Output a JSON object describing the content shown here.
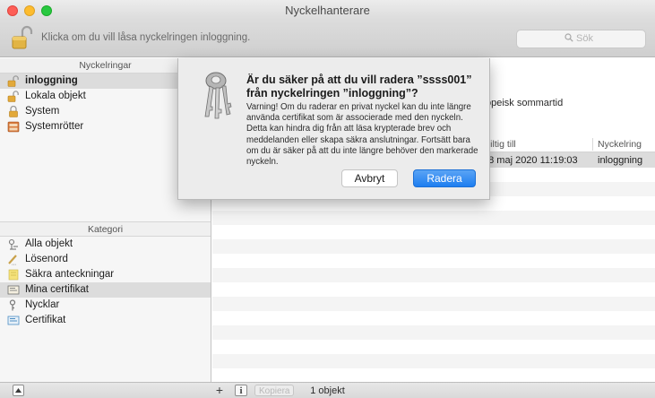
{
  "window": {
    "title": "Nyckelhanterare"
  },
  "toolbar": {
    "lock_hint": "Klicka om du vill låsa nyckelringen inloggning.",
    "search_placeholder": "Sök"
  },
  "sidebar": {
    "keychains_header": "Nyckelringar",
    "keychains": [
      {
        "label": "inloggning",
        "icon": "unlocked-padlock-icon",
        "selected": true
      },
      {
        "label": "Lokala objekt",
        "icon": "unlocked-padlock-icon",
        "selected": false
      },
      {
        "label": "System",
        "icon": "locked-padlock-icon",
        "selected": false
      },
      {
        "label": "Systemrötter",
        "icon": "cabinet-icon",
        "selected": false
      }
    ],
    "category_header": "Kategori",
    "categories": [
      {
        "label": "Alla objekt",
        "icon": "all-items-icon",
        "selected": false
      },
      {
        "label": "Lösenord",
        "icon": "password-pencil-icon",
        "selected": false
      },
      {
        "label": "Säkra anteckningar",
        "icon": "note-icon",
        "selected": false
      },
      {
        "label": "Mina certifikat",
        "icon": "my-certificate-icon",
        "selected": true
      },
      {
        "label": "Nycklar",
        "icon": "key-icon",
        "selected": false
      },
      {
        "label": "Certifikat",
        "icon": "certificate-icon",
        "selected": false
      }
    ]
  },
  "main": {
    "detail_text": "opeisk sommartid",
    "columns": {
      "expires": "Giltig till",
      "keychain": "Nyckelring"
    },
    "rows": [
      {
        "expires": "28 maj 2020 11:19:03",
        "keychain": "inloggning"
      }
    ]
  },
  "dialog": {
    "title": "Är du säker på att du vill radera ”ssss001” från nyckelringen ”inloggning”?",
    "message": "Varning! Om du raderar en privat nyckel kan du inte längre använda certifikat som är associerade med den nyckeln. Detta kan hindra dig från att läsa krypterade brev och meddelanden eller skapa säkra anslutningar. Fortsätt bara om du är säker på att du inte längre behöver den markerade nyckeln.",
    "cancel_label": "Avbryt",
    "confirm_label": "Radera",
    "icon": "keys-icon"
  },
  "bottom_bar": {
    "add_label": "+",
    "info_label": "i",
    "copy_label": "Kopiera",
    "status": "1 objekt"
  },
  "colors": {
    "accent": "#1e7ef0",
    "selection": "#dcdcdc",
    "close": "#fd5e56",
    "minimize": "#fdbc2e",
    "maximize": "#28c840"
  }
}
